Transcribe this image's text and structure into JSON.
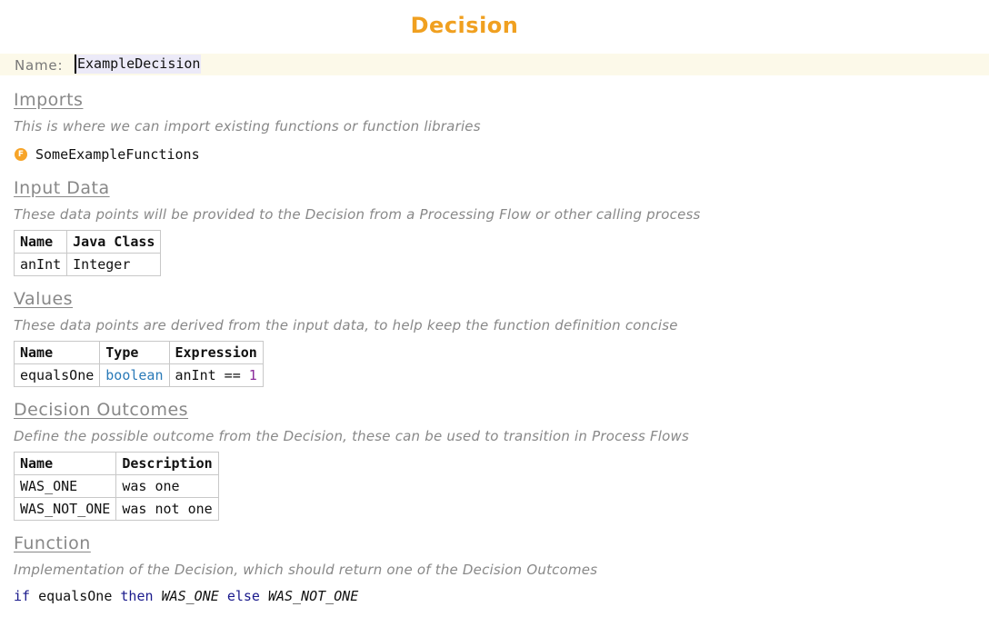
{
  "header": {
    "title": "Decision"
  },
  "name_field": {
    "label": "Name:",
    "value": "ExampleDecision"
  },
  "imports": {
    "heading": "Imports",
    "description": "This is where we can import existing functions or function libraries",
    "items": [
      {
        "icon": "function-icon",
        "icon_letter": "F",
        "name": "SomeExampleFunctions"
      }
    ]
  },
  "input_data": {
    "heading": "Input Data",
    "description": "These data points will be provided to the Decision from a Processing Flow or other calling process",
    "columns": [
      "Name",
      "Java Class"
    ],
    "rows": [
      [
        "anInt",
        "Integer"
      ]
    ]
  },
  "values": {
    "heading": "Values",
    "description": "These data points are derived from the input data, to help keep the function definition concise",
    "columns": [
      "Name",
      "Type",
      "Expression"
    ],
    "rows": [
      {
        "name": "equalsOne",
        "type": "boolean",
        "expr_left": "anInt ==",
        "expr_num": "1"
      }
    ]
  },
  "outcomes": {
    "heading": "Decision Outcomes",
    "description": "Define the possible outcome from the Decision, these can be used to transition in Process Flows",
    "columns": [
      "Name",
      "Description"
    ],
    "rows": [
      [
        "WAS_ONE",
        "was one"
      ],
      [
        "WAS_NOT_ONE",
        "was not one"
      ]
    ]
  },
  "function": {
    "heading": "Function",
    "description": "Implementation of the Decision, which should return one of the Decision Outcomes",
    "code": {
      "kw_if": "if",
      "condition": "equalsOne",
      "kw_then": "then",
      "then_value": "WAS_ONE",
      "kw_else": "else",
      "else_value": "WAS_NOT_ONE"
    }
  },
  "colors": {
    "title": "#f0a020",
    "icon": "#f7a428",
    "type_keyword": "#2a7ab8",
    "number": "#8a2a9a",
    "keyword": "#1a1a8c"
  }
}
